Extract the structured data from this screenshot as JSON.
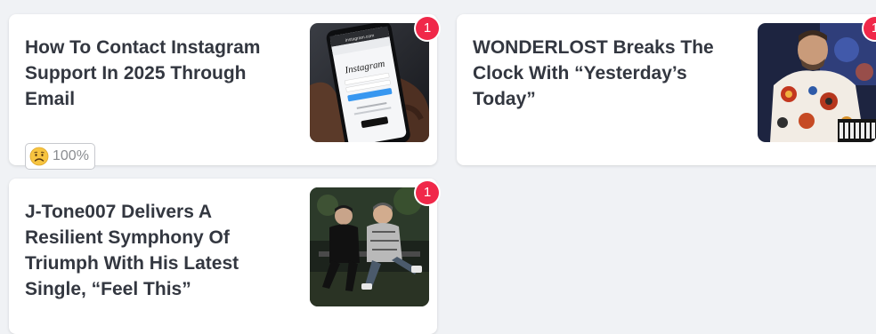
{
  "cards": [
    {
      "title": "How To Contact Instagram Support In 2025 Through Email",
      "badge": "1",
      "reaction": {
        "icon": "sad-face-icon",
        "percent": "100%"
      },
      "image": "phone-instagram-photo"
    },
    {
      "title": "WONDERLOST Breaks The Clock With “Yesterday’s Today”",
      "badge": "1",
      "image": "musician-keyboard-photo"
    },
    {
      "title": "J-Tone007 Delivers A Resilient Symphony Of Triumph With His Latest Single, “Feel This”",
      "badge": "1",
      "image": "two-men-sitting-photo"
    }
  ],
  "phone_screen": {
    "logo": "Instagram"
  },
  "colors": {
    "badge": "#f02849",
    "title": "#333740",
    "background": "#f0f2f5",
    "card": "#ffffff"
  }
}
